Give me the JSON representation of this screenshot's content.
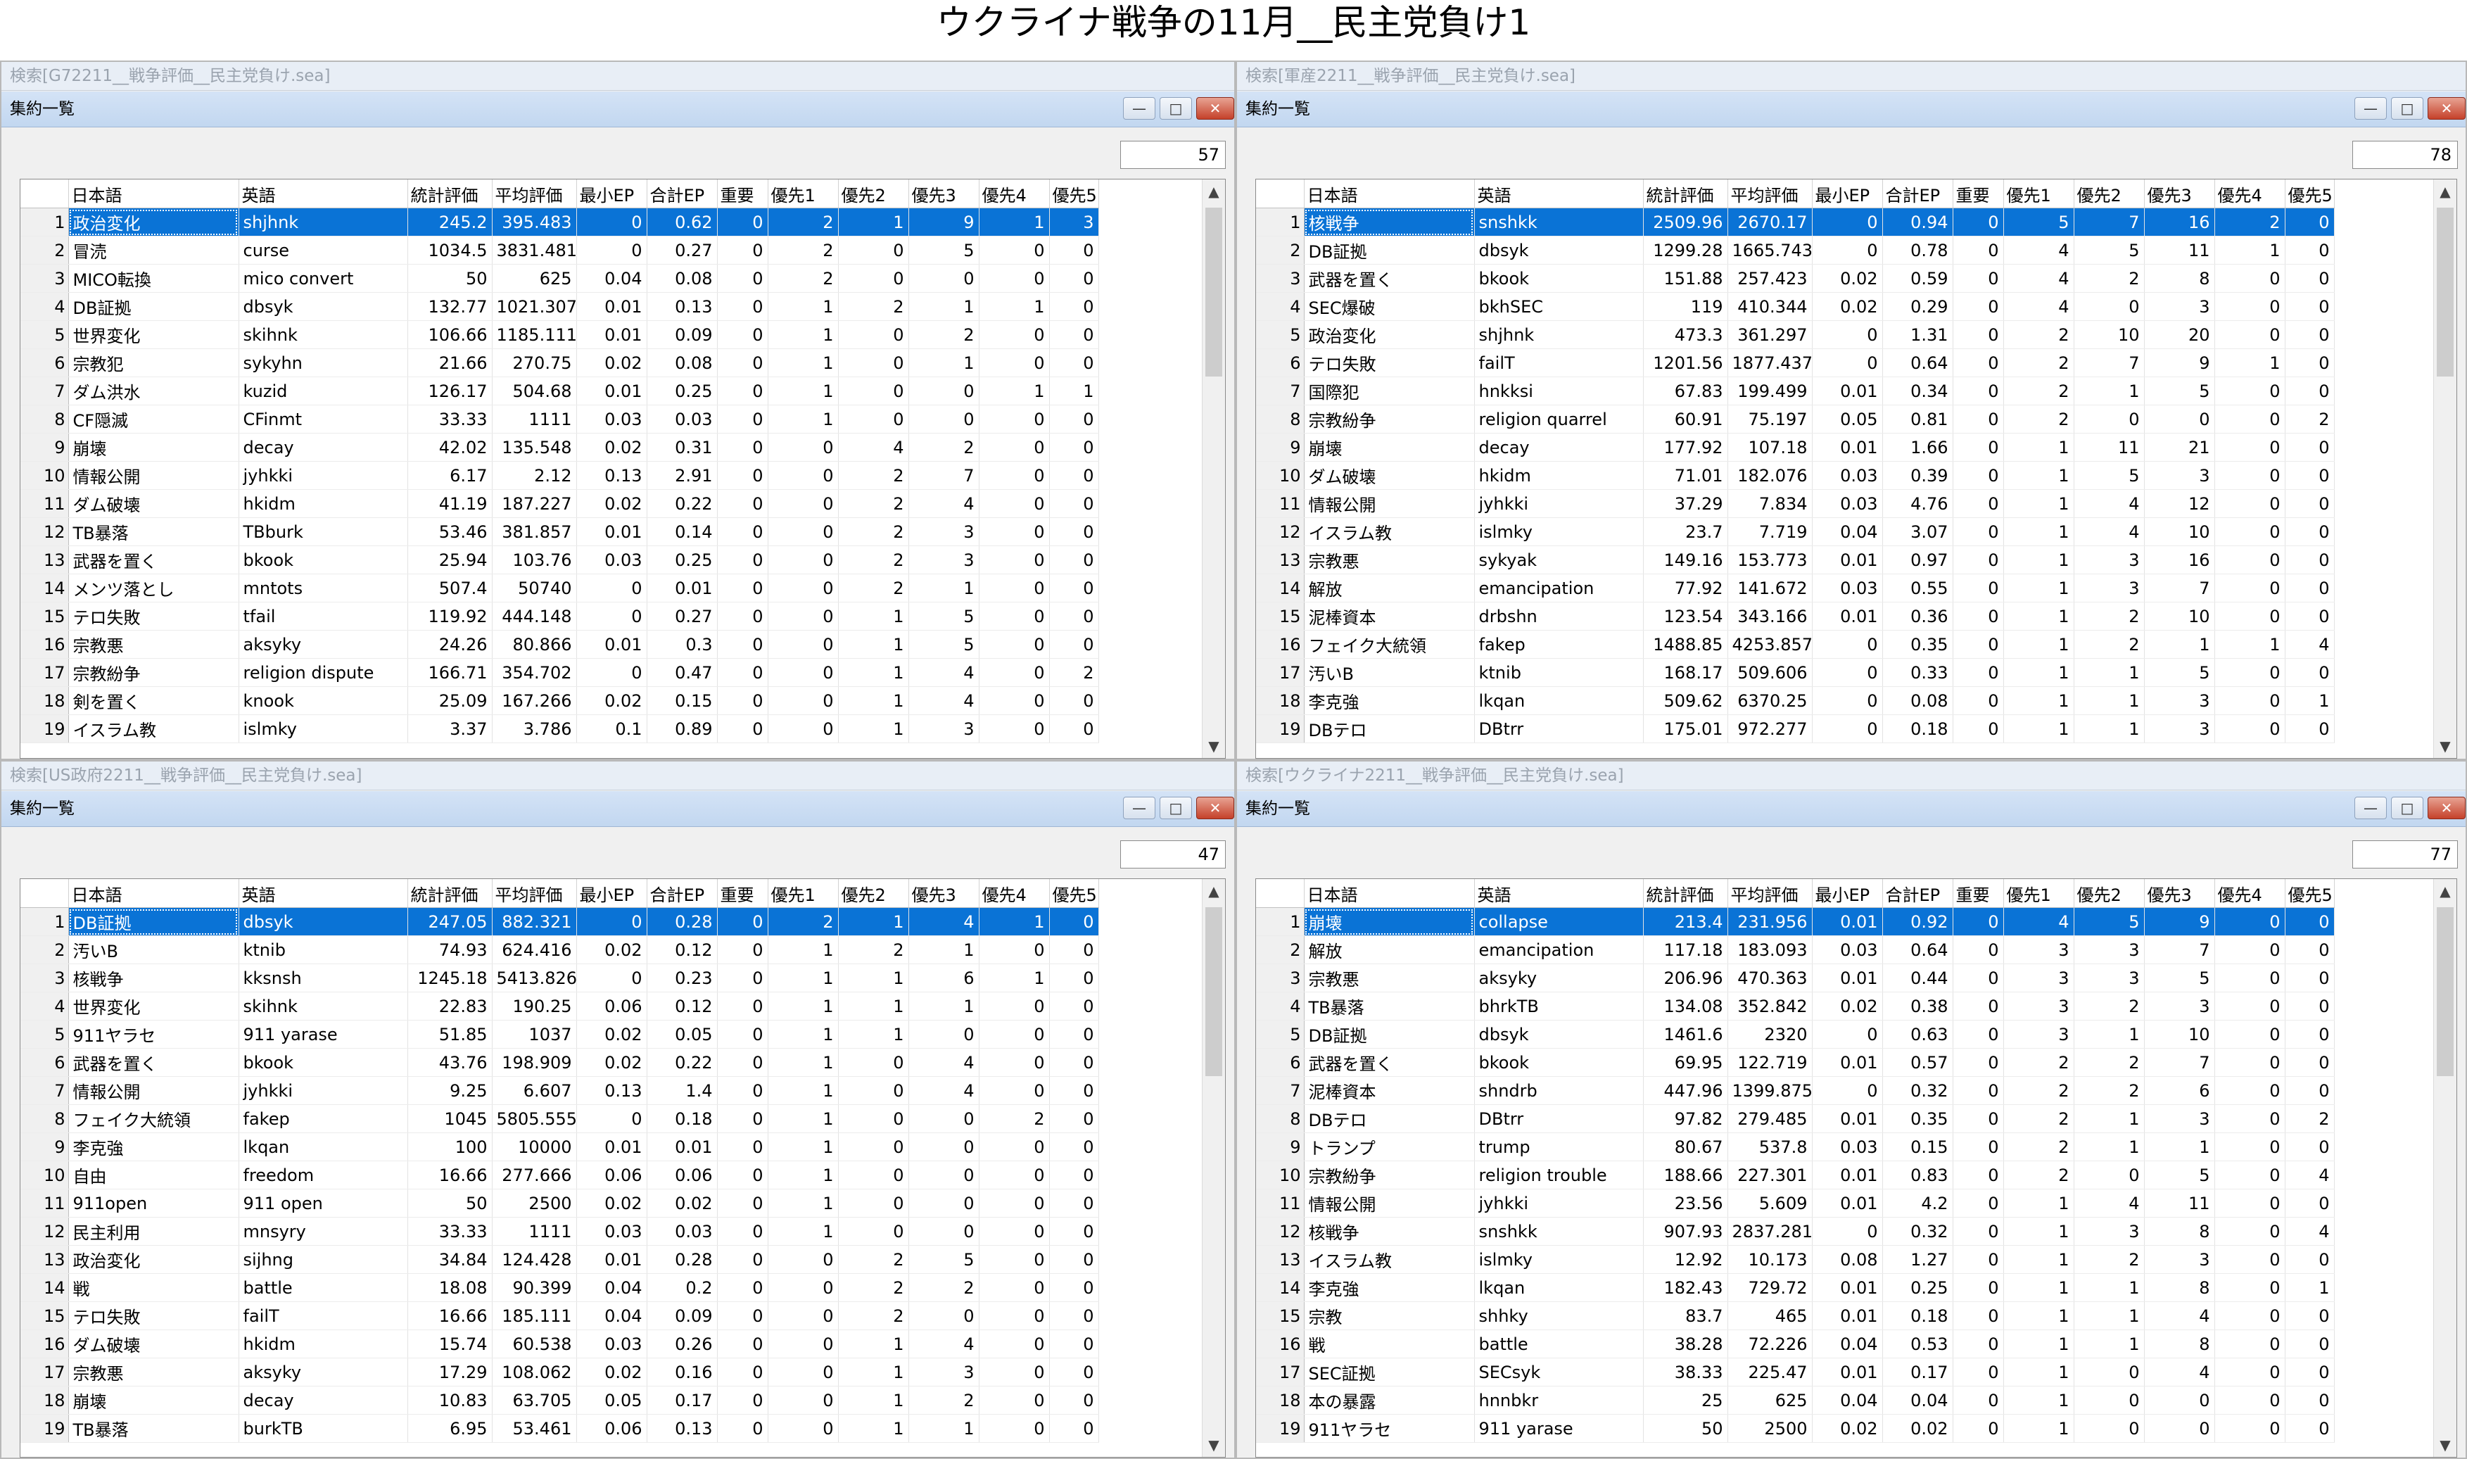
{
  "page_title": "ウクライナ戦争の11月__民主党負け1",
  "columns": [
    "日本語",
    "英語",
    "統計評価",
    "平均評価",
    "最小EP",
    "合計EP",
    "重要",
    "優先1",
    "優先2",
    "優先3",
    "優先4",
    "優先5",
    "優先"
  ],
  "icons": {
    "minimize": "minimize-icon",
    "maximize": "maximize-icon",
    "close": "close-icon",
    "scroll_up": "chevron-up-icon",
    "scroll_down": "chevron-down-icon"
  },
  "colors": {
    "selection": "#0a73d6",
    "titlebar": "#c8dbf2",
    "close_button": "#c5412a"
  },
  "panels": [
    {
      "outer_title": "検索[G72211__戦争評価__民主党負け.sea]",
      "inner_title": "集約一覧",
      "count": "57",
      "selected_row": 0,
      "rows": [
        [
          "1",
          "政治変化",
          "shjhnk",
          "245.2",
          "395.483",
          "0",
          "0.62",
          "0",
          "2",
          "1",
          "9",
          "1",
          "3"
        ],
        [
          "2",
          "冒涜",
          "curse",
          "1034.5",
          "3831.481",
          "0",
          "0.27",
          "0",
          "2",
          "0",
          "5",
          "0",
          "0"
        ],
        [
          "3",
          "MICO転換",
          "mico convert",
          "50",
          "625",
          "0.04",
          "0.08",
          "0",
          "2",
          "0",
          "0",
          "0",
          "0"
        ],
        [
          "4",
          "DB証拠",
          "dbsyk",
          "132.77",
          "1021.307",
          "0.01",
          "0.13",
          "0",
          "1",
          "2",
          "1",
          "1",
          "0"
        ],
        [
          "5",
          "世界変化",
          "skihnk",
          "106.66",
          "1185.111",
          "0.01",
          "0.09",
          "0",
          "1",
          "0",
          "2",
          "0",
          "0"
        ],
        [
          "6",
          "宗教犯",
          "sykyhn",
          "21.66",
          "270.75",
          "0.02",
          "0.08",
          "0",
          "1",
          "0",
          "1",
          "0",
          "0"
        ],
        [
          "7",
          "ダム洪水",
          "kuzid",
          "126.17",
          "504.68",
          "0.01",
          "0.25",
          "0",
          "1",
          "0",
          "0",
          "1",
          "1"
        ],
        [
          "8",
          "CF隠滅",
          "CFinmt",
          "33.33",
          "1111",
          "0.03",
          "0.03",
          "0",
          "1",
          "0",
          "0",
          "0",
          "0"
        ],
        [
          "9",
          "崩壊",
          "decay",
          "42.02",
          "135.548",
          "0.02",
          "0.31",
          "0",
          "0",
          "4",
          "2",
          "0",
          "0"
        ],
        [
          "10",
          "情報公開",
          "jyhkki",
          "6.17",
          "2.12",
          "0.13",
          "2.91",
          "0",
          "0",
          "2",
          "7",
          "0",
          "0"
        ],
        [
          "11",
          "ダム破壊",
          "hkidm",
          "41.19",
          "187.227",
          "0.02",
          "0.22",
          "0",
          "0",
          "2",
          "4",
          "0",
          "0"
        ],
        [
          "12",
          "TB暴落",
          "TBburk",
          "53.46",
          "381.857",
          "0.01",
          "0.14",
          "0",
          "0",
          "2",
          "3",
          "0",
          "0"
        ],
        [
          "13",
          "武器を置く",
          "bkook",
          "25.94",
          "103.76",
          "0.03",
          "0.25",
          "0",
          "0",
          "2",
          "3",
          "0",
          "0"
        ],
        [
          "14",
          "メンツ落とし",
          "mntots",
          "507.4",
          "50740",
          "0",
          "0.01",
          "0",
          "0",
          "2",
          "1",
          "0",
          "0"
        ],
        [
          "15",
          "テロ失敗",
          "tfail",
          "119.92",
          "444.148",
          "0",
          "0.27",
          "0",
          "0",
          "1",
          "5",
          "0",
          "0"
        ],
        [
          "16",
          "宗教悪",
          "aksyky",
          "24.26",
          "80.866",
          "0.01",
          "0.3",
          "0",
          "0",
          "1",
          "5",
          "0",
          "0"
        ],
        [
          "17",
          "宗教紛争",
          "religion dispute",
          "166.71",
          "354.702",
          "0",
          "0.47",
          "0",
          "0",
          "1",
          "4",
          "0",
          "2"
        ],
        [
          "18",
          "剣を置く",
          "knook",
          "25.09",
          "167.266",
          "0.02",
          "0.15",
          "0",
          "0",
          "1",
          "4",
          "0",
          "0"
        ],
        [
          "19",
          "イスラム教",
          "islmky",
          "3.37",
          "3.786",
          "0.1",
          "0.89",
          "0",
          "0",
          "1",
          "3",
          "0",
          "0"
        ]
      ]
    },
    {
      "outer_title": "検索[軍産2211__戦争評価__民主党負け.sea]",
      "inner_title": "集約一覧",
      "count": "78",
      "selected_row": 0,
      "rows": [
        [
          "1",
          "核戦争",
          "snshkk",
          "2509.96",
          "2670.17",
          "0",
          "0.94",
          "0",
          "5",
          "7",
          "16",
          "2",
          "0"
        ],
        [
          "2",
          "DB証拠",
          "dbsyk",
          "1299.28",
          "1665.743",
          "0",
          "0.78",
          "0",
          "4",
          "5",
          "11",
          "1",
          "0"
        ],
        [
          "3",
          "武器を置く",
          "bkook",
          "151.88",
          "257.423",
          "0.02",
          "0.59",
          "0",
          "4",
          "2",
          "8",
          "0",
          "0"
        ],
        [
          "4",
          "SEC爆破",
          "bkhSEC",
          "119",
          "410.344",
          "0.02",
          "0.29",
          "0",
          "4",
          "0",
          "3",
          "0",
          "0"
        ],
        [
          "5",
          "政治変化",
          "shjhnk",
          "473.3",
          "361.297",
          "0",
          "1.31",
          "0",
          "2",
          "10",
          "20",
          "0",
          "0"
        ],
        [
          "6",
          "テロ失敗",
          "failT",
          "1201.56",
          "1877.437",
          "0",
          "0.64",
          "0",
          "2",
          "7",
          "9",
          "1",
          "0"
        ],
        [
          "7",
          "国際犯",
          "hnkksi",
          "67.83",
          "199.499",
          "0.01",
          "0.34",
          "0",
          "2",
          "1",
          "5",
          "0",
          "0"
        ],
        [
          "8",
          "宗教紛争",
          "religion quarrel",
          "60.91",
          "75.197",
          "0.05",
          "0.81",
          "0",
          "2",
          "0",
          "0",
          "0",
          "2"
        ],
        [
          "9",
          "崩壊",
          "decay",
          "177.92",
          "107.18",
          "0.01",
          "1.66",
          "0",
          "1",
          "11",
          "21",
          "0",
          "0"
        ],
        [
          "10",
          "ダム破壊",
          "hkidm",
          "71.01",
          "182.076",
          "0.03",
          "0.39",
          "0",
          "1",
          "5",
          "3",
          "0",
          "0"
        ],
        [
          "11",
          "情報公開",
          "jyhkki",
          "37.29",
          "7.834",
          "0.03",
          "4.76",
          "0",
          "1",
          "4",
          "12",
          "0",
          "0"
        ],
        [
          "12",
          "イスラム教",
          "islmky",
          "23.7",
          "7.719",
          "0.04",
          "3.07",
          "0",
          "1",
          "4",
          "10",
          "0",
          "0"
        ],
        [
          "13",
          "宗教悪",
          "sykyak",
          "149.16",
          "153.773",
          "0.01",
          "0.97",
          "0",
          "1",
          "3",
          "16",
          "0",
          "0"
        ],
        [
          "14",
          "解放",
          "emancipation",
          "77.92",
          "141.672",
          "0.03",
          "0.55",
          "0",
          "1",
          "3",
          "7",
          "0",
          "0"
        ],
        [
          "15",
          "泥棒資本",
          "drbshn",
          "123.54",
          "343.166",
          "0.01",
          "0.36",
          "0",
          "1",
          "2",
          "10",
          "0",
          "0"
        ],
        [
          "16",
          "フェイク大統領",
          "fakep",
          "1488.85",
          "4253.857",
          "0",
          "0.35",
          "0",
          "1",
          "2",
          "1",
          "1",
          "4"
        ],
        [
          "17",
          "汚いB",
          "ktnib",
          "168.17",
          "509.606",
          "0",
          "0.33",
          "0",
          "1",
          "1",
          "5",
          "0",
          "0"
        ],
        [
          "18",
          "李克強",
          "lkqan",
          "509.62",
          "6370.25",
          "0",
          "0.08",
          "0",
          "1",
          "1",
          "3",
          "0",
          "1"
        ],
        [
          "19",
          "DBテロ",
          "DBtrr",
          "175.01",
          "972.277",
          "0",
          "0.18",
          "0",
          "1",
          "1",
          "3",
          "0",
          "0"
        ]
      ]
    },
    {
      "outer_title": "検索[US政府2211__戦争評価__民主党負け.sea]",
      "inner_title": "集約一覧",
      "count": "47",
      "selected_row": 0,
      "rows": [
        [
          "1",
          "DB証拠",
          "dbsyk",
          "247.05",
          "882.321",
          "0",
          "0.28",
          "0",
          "2",
          "1",
          "4",
          "1",
          "0"
        ],
        [
          "2",
          "汚いB",
          "ktnib",
          "74.93",
          "624.416",
          "0.02",
          "0.12",
          "0",
          "1",
          "2",
          "1",
          "0",
          "0"
        ],
        [
          "3",
          "核戦争",
          "kksnsh",
          "1245.18",
          "5413.826",
          "0",
          "0.23",
          "0",
          "1",
          "1",
          "6",
          "1",
          "0"
        ],
        [
          "4",
          "世界変化",
          "skihnk",
          "22.83",
          "190.25",
          "0.06",
          "0.12",
          "0",
          "1",
          "1",
          "1",
          "0",
          "0"
        ],
        [
          "5",
          "911ヤラセ",
          "911 yarase",
          "51.85",
          "1037",
          "0.02",
          "0.05",
          "0",
          "1",
          "1",
          "0",
          "0",
          "0"
        ],
        [
          "6",
          "武器を置く",
          "bkook",
          "43.76",
          "198.909",
          "0.02",
          "0.22",
          "0",
          "1",
          "0",
          "4",
          "0",
          "0"
        ],
        [
          "7",
          "情報公開",
          "jyhkki",
          "9.25",
          "6.607",
          "0.13",
          "1.4",
          "0",
          "1",
          "0",
          "4",
          "0",
          "0"
        ],
        [
          "8",
          "フェイク大統領",
          "fakep",
          "1045",
          "5805.555",
          "0",
          "0.18",
          "0",
          "1",
          "0",
          "0",
          "2",
          "0"
        ],
        [
          "9",
          "李克強",
          "lkqan",
          "100",
          "10000",
          "0.01",
          "0.01",
          "0",
          "1",
          "0",
          "0",
          "0",
          "0"
        ],
        [
          "10",
          "自由",
          "freedom",
          "16.66",
          "277.666",
          "0.06",
          "0.06",
          "0",
          "1",
          "0",
          "0",
          "0",
          "0"
        ],
        [
          "11",
          "911open",
          "911 open",
          "50",
          "2500",
          "0.02",
          "0.02",
          "0",
          "1",
          "0",
          "0",
          "0",
          "0"
        ],
        [
          "12",
          "民主利用",
          "mnsyry",
          "33.33",
          "1111",
          "0.03",
          "0.03",
          "0",
          "1",
          "0",
          "0",
          "0",
          "0"
        ],
        [
          "13",
          "政治変化",
          "sijhng",
          "34.84",
          "124.428",
          "0.01",
          "0.28",
          "0",
          "0",
          "2",
          "5",
          "0",
          "0"
        ],
        [
          "14",
          "戦",
          "battle",
          "18.08",
          "90.399",
          "0.04",
          "0.2",
          "0",
          "0",
          "2",
          "2",
          "0",
          "0"
        ],
        [
          "15",
          "テロ失敗",
          "failT",
          "16.66",
          "185.111",
          "0.04",
          "0.09",
          "0",
          "0",
          "2",
          "0",
          "0",
          "0"
        ],
        [
          "16",
          "ダム破壊",
          "hkidm",
          "15.74",
          "60.538",
          "0.03",
          "0.26",
          "0",
          "0",
          "1",
          "4",
          "0",
          "0"
        ],
        [
          "17",
          "宗教悪",
          "aksyky",
          "17.29",
          "108.062",
          "0.02",
          "0.16",
          "0",
          "0",
          "1",
          "3",
          "0",
          "0"
        ],
        [
          "18",
          "崩壊",
          "decay",
          "10.83",
          "63.705",
          "0.05",
          "0.17",
          "0",
          "0",
          "1",
          "2",
          "0",
          "0"
        ],
        [
          "19",
          "TB暴落",
          "burkTB",
          "6.95",
          "53.461",
          "0.06",
          "0.13",
          "0",
          "0",
          "1",
          "1",
          "0",
          "0"
        ]
      ]
    },
    {
      "outer_title": "検索[ウクライナ2211__戦争評価__民主党負け.sea]",
      "inner_title": "集約一覧",
      "count": "77",
      "selected_row": 0,
      "rows": [
        [
          "1",
          "崩壊",
          "collapse",
          "213.4",
          "231.956",
          "0.01",
          "0.92",
          "0",
          "4",
          "5",
          "9",
          "0",
          "0"
        ],
        [
          "2",
          "解放",
          "emancipation",
          "117.18",
          "183.093",
          "0.03",
          "0.64",
          "0",
          "3",
          "3",
          "7",
          "0",
          "0"
        ],
        [
          "3",
          "宗教悪",
          "aksyky",
          "206.96",
          "470.363",
          "0.01",
          "0.44",
          "0",
          "3",
          "3",
          "5",
          "0",
          "0"
        ],
        [
          "4",
          "TB暴落",
          "bhrkTB",
          "134.08",
          "352.842",
          "0.02",
          "0.38",
          "0",
          "3",
          "2",
          "3",
          "0",
          "0"
        ],
        [
          "5",
          "DB証拠",
          "dbsyk",
          "1461.6",
          "2320",
          "0",
          "0.63",
          "0",
          "3",
          "1",
          "10",
          "0",
          "0"
        ],
        [
          "6",
          "武器を置く",
          "bkook",
          "69.95",
          "122.719",
          "0.01",
          "0.57",
          "0",
          "2",
          "2",
          "7",
          "0",
          "0"
        ],
        [
          "7",
          "泥棒資本",
          "shndrb",
          "447.96",
          "1399.875",
          "0",
          "0.32",
          "0",
          "2",
          "2",
          "6",
          "0",
          "0"
        ],
        [
          "8",
          "DBテロ",
          "DBtrr",
          "97.82",
          "279.485",
          "0.01",
          "0.35",
          "0",
          "2",
          "1",
          "3",
          "0",
          "2"
        ],
        [
          "9",
          "トランプ",
          "trump",
          "80.67",
          "537.8",
          "0.03",
          "0.15",
          "0",
          "2",
          "1",
          "1",
          "0",
          "0"
        ],
        [
          "10",
          "宗教紛争",
          "religion trouble",
          "188.66",
          "227.301",
          "0.01",
          "0.83",
          "0",
          "2",
          "0",
          "5",
          "0",
          "4"
        ],
        [
          "11",
          "情報公開",
          "jyhkki",
          "23.56",
          "5.609",
          "0.01",
          "4.2",
          "0",
          "1",
          "4",
          "11",
          "0",
          "0"
        ],
        [
          "12",
          "核戦争",
          "snshkk",
          "907.93",
          "2837.281",
          "0",
          "0.32",
          "0",
          "1",
          "3",
          "8",
          "0",
          "4"
        ],
        [
          "13",
          "イスラム教",
          "islmky",
          "12.92",
          "10.173",
          "0.08",
          "1.27",
          "0",
          "1",
          "2",
          "3",
          "0",
          "0"
        ],
        [
          "14",
          "李克強",
          "lkqan",
          "182.43",
          "729.72",
          "0.01",
          "0.25",
          "0",
          "1",
          "1",
          "8",
          "0",
          "1"
        ],
        [
          "15",
          "宗教",
          "shhky",
          "83.7",
          "465",
          "0.01",
          "0.18",
          "0",
          "1",
          "1",
          "4",
          "0",
          "0"
        ],
        [
          "16",
          "戦",
          "battle",
          "38.28",
          "72.226",
          "0.04",
          "0.53",
          "0",
          "1",
          "1",
          "8",
          "0",
          "0"
        ],
        [
          "17",
          "SEC証拠",
          "SECsyk",
          "38.33",
          "225.47",
          "0.01",
          "0.17",
          "0",
          "1",
          "0",
          "4",
          "0",
          "0"
        ],
        [
          "18",
          "本の暴露",
          "hnnbkr",
          "25",
          "625",
          "0.04",
          "0.04",
          "0",
          "1",
          "0",
          "0",
          "0",
          "0"
        ],
        [
          "19",
          "911ヤラセ",
          "911 yarase",
          "50",
          "2500",
          "0.02",
          "0.02",
          "0",
          "1",
          "0",
          "0",
          "0",
          "0"
        ]
      ]
    }
  ]
}
